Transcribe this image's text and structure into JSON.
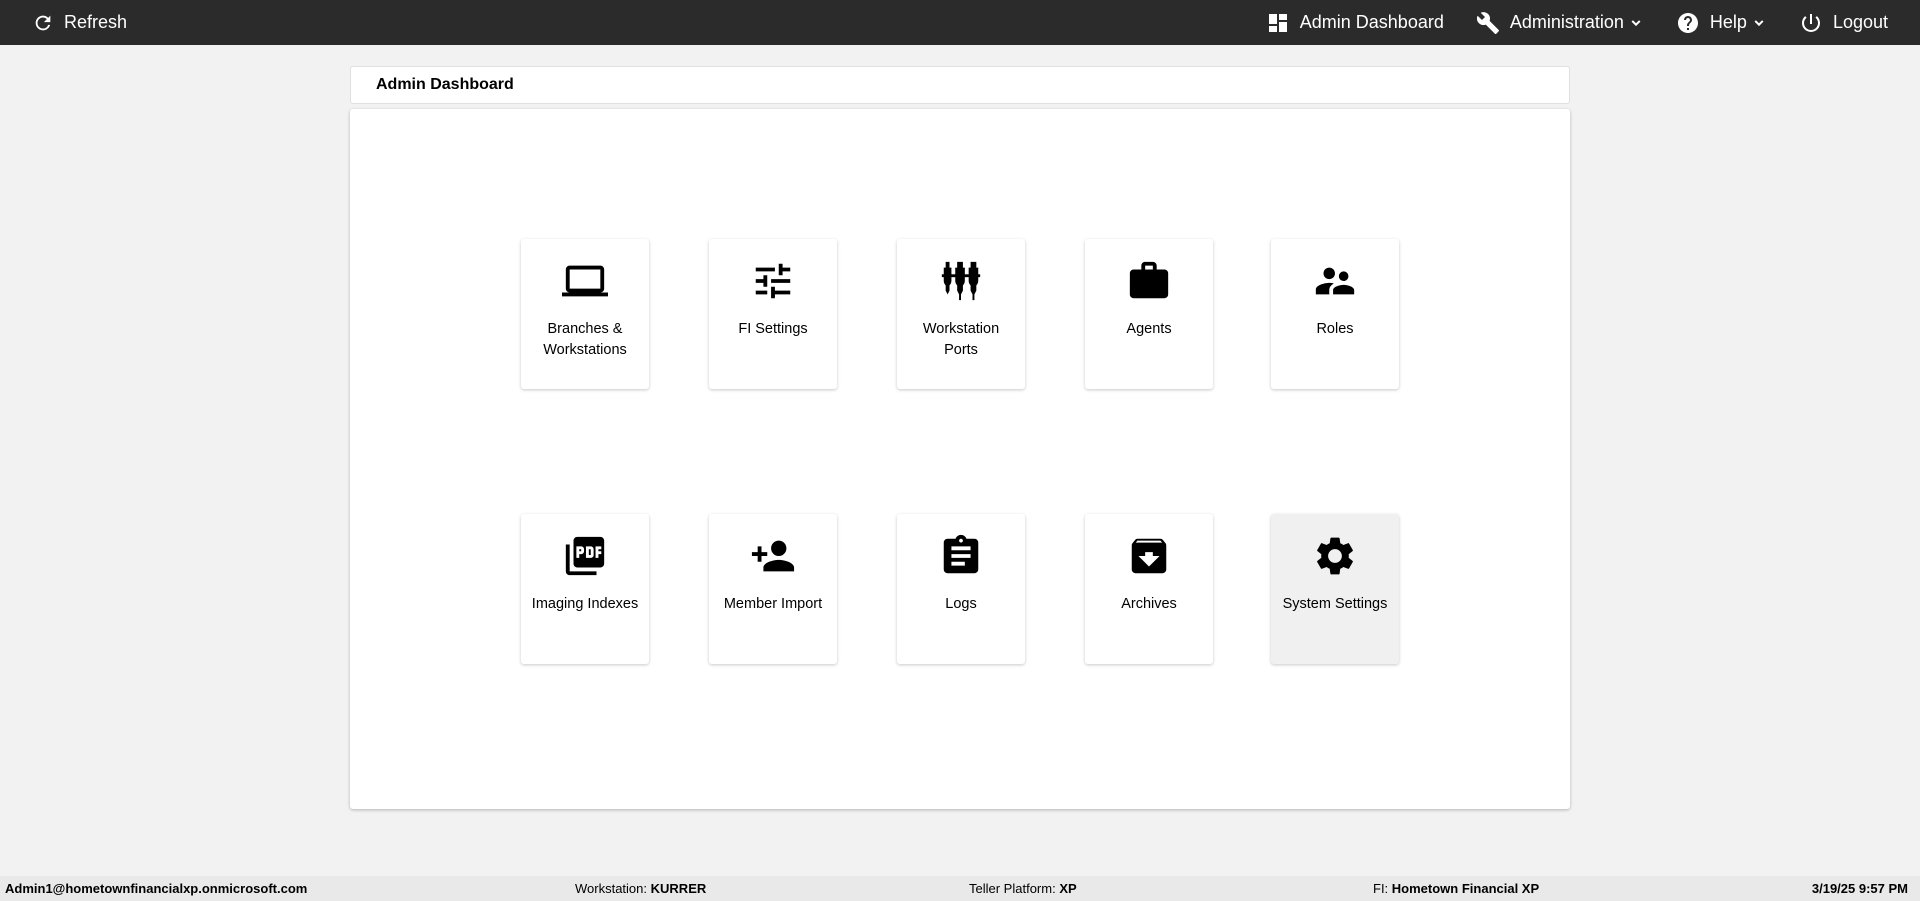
{
  "topbar": {
    "refresh_label": "Refresh",
    "dashboard_label": "Admin Dashboard",
    "administration_label": "Administration",
    "help_label": "Help",
    "logout_label": "Logout"
  },
  "page": {
    "title": "Admin Dashboard"
  },
  "tiles": [
    {
      "label": "Branches & Workstations",
      "icon": "laptop-icon"
    },
    {
      "label": "FI Settings",
      "icon": "tune-icon"
    },
    {
      "label": "Workstation Ports",
      "icon": "ports-icon"
    },
    {
      "label": "Agents",
      "icon": "briefcase-icon"
    },
    {
      "label": "Roles",
      "icon": "people-icon"
    },
    {
      "label": "Imaging Indexes",
      "icon": "pdf-icon"
    },
    {
      "label": "Member Import",
      "icon": "person-add-icon"
    },
    {
      "label": "Logs",
      "icon": "clipboard-icon"
    },
    {
      "label": "Archives",
      "icon": "archive-icon"
    },
    {
      "label": "System Settings",
      "icon": "gear-icon"
    }
  ],
  "footer": {
    "user": "Admin1@hometownfinancialxp.onmicrosoft.com",
    "workstation_label": "Workstation:",
    "workstation_value": "KURRER",
    "platform_label": "Teller Platform:",
    "platform_value": "XP",
    "fi_label": "FI:",
    "fi_value": "Hometown Financial XP",
    "datetime": "3/19/25 9:57 PM"
  }
}
